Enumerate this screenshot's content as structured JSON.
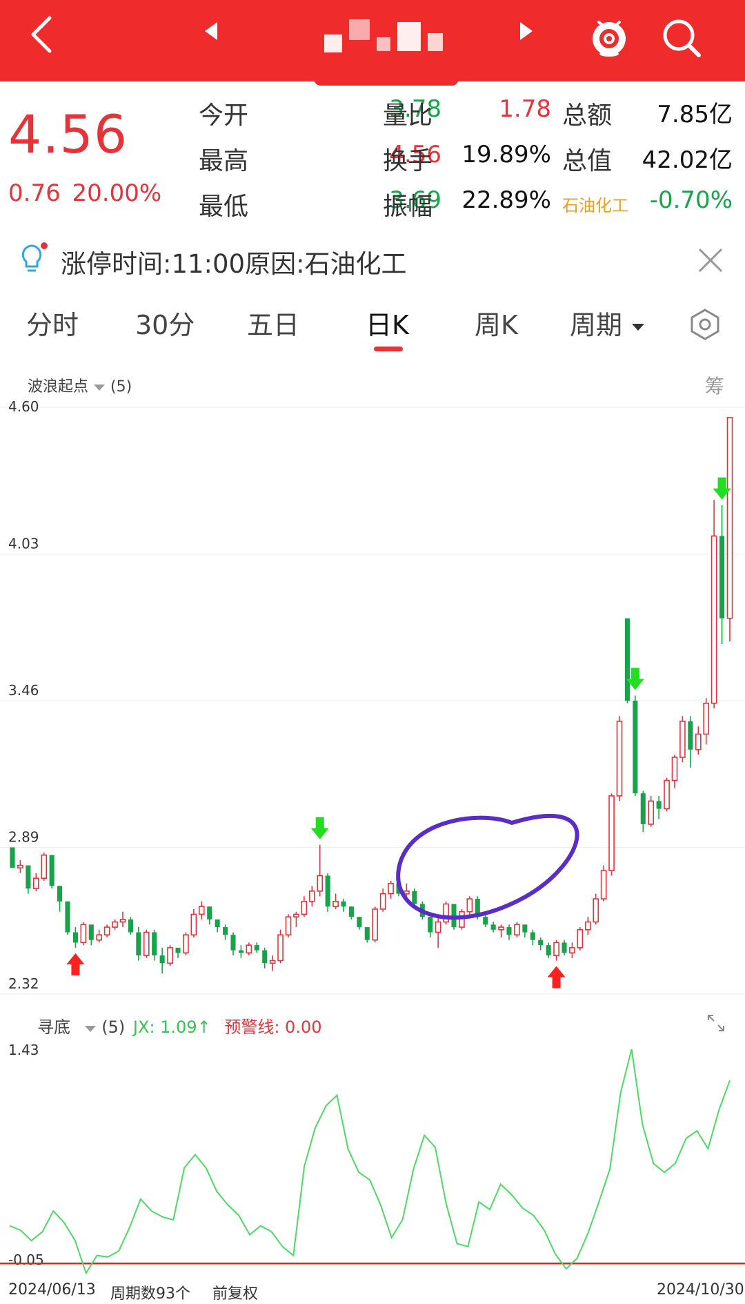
{
  "header": {
    "back_icon": "chevron-left-icon",
    "prev_icon": "triangle-left-icon",
    "next_icon": "triangle-right-icon",
    "mascot_icon": "mascot-icon",
    "search_icon": "search-icon"
  },
  "quote": {
    "price": "4.56",
    "change": "0.76",
    "change_pct": "20.00%",
    "rows": [
      [
        {
          "label": "今开",
          "value": "3.78",
          "color": "green"
        },
        {
          "label": "量比",
          "value": "1.78",
          "color": "red"
        },
        {
          "label": "总额",
          "value": "7.85亿",
          "color": "dark"
        }
      ],
      [
        {
          "label": "最高",
          "value": "4.56",
          "color": "red"
        },
        {
          "label": "换手",
          "value": "19.89%",
          "color": "dark"
        },
        {
          "label": "总值",
          "value": "42.02亿",
          "color": "dark"
        }
      ],
      [
        {
          "label": "最低",
          "value": "3.69",
          "color": "green"
        },
        {
          "label": "振幅",
          "value": "22.89%",
          "color": "dark"
        },
        {
          "label": "石油化工",
          "value": "-0.70%",
          "color": "green"
        }
      ]
    ]
  },
  "limit_info": {
    "text": "涨停时间:11:00原因:石油化工",
    "icon": "lightbulb-icon",
    "close_icon": "close-icon"
  },
  "tabs": {
    "items": [
      "分时",
      "30分",
      "五日",
      "日K",
      "周K",
      "周期"
    ],
    "active": "日K",
    "dropdown_icon": "caret-down-icon",
    "settings_icon": "hexagon-settings-icon"
  },
  "main_indicator": {
    "name": "波浪起点",
    "param": "(5)",
    "chips_label": "筹"
  },
  "sub_indicator": {
    "name": "寻底",
    "param": "(5)",
    "jx_text": "JX: 1.09↑",
    "warn_text": "预警线: 0.00",
    "expand_icon": "expand-icon"
  },
  "footer": {
    "start_date": "2024/06/13",
    "period_count": "周期数93个",
    "adjust": "前复权",
    "end_date": "2024/10/30"
  },
  "colors": {
    "brand_red": "#f02b2b",
    "up_red": "#e8323a",
    "down_green": "#18a24a",
    "jx_line": "#4cd964",
    "circle": "#5a2dc8"
  },
  "chart_data": [
    {
      "type": "candlestick",
      "title": "",
      "yticks": [
        "4.60",
        "4.03",
        "3.46",
        "2.89",
        "2.32"
      ],
      "ylim": [
        2.32,
        4.6
      ],
      "candles": [
        [
          2.89,
          2.89,
          2.81,
          2.81
        ],
        [
          2.81,
          2.84,
          2.79,
          2.82
        ],
        [
          2.82,
          2.82,
          2.71,
          2.73
        ],
        [
          2.73,
          2.79,
          2.72,
          2.77
        ],
        [
          2.77,
          2.87,
          2.76,
          2.86
        ],
        [
          2.86,
          2.86,
          2.73,
          2.74
        ],
        [
          2.74,
          2.74,
          2.64,
          2.68
        ],
        [
          2.68,
          2.68,
          2.55,
          2.56
        ],
        [
          2.56,
          2.58,
          2.5,
          2.52
        ],
        [
          2.52,
          2.6,
          2.51,
          2.59
        ],
        [
          2.59,
          2.59,
          2.51,
          2.53
        ],
        [
          2.53,
          2.57,
          2.52,
          2.55
        ],
        [
          2.55,
          2.59,
          2.54,
          2.58
        ],
        [
          2.58,
          2.61,
          2.57,
          2.6
        ],
        [
          2.6,
          2.64,
          2.58,
          2.61
        ],
        [
          2.61,
          2.62,
          2.55,
          2.56
        ],
        [
          2.56,
          2.58,
          2.45,
          2.47
        ],
        [
          2.47,
          2.57,
          2.46,
          2.56
        ],
        [
          2.56,
          2.57,
          2.45,
          2.47
        ],
        [
          2.47,
          2.5,
          2.4,
          2.44
        ],
        [
          2.44,
          2.51,
          2.43,
          2.5
        ],
        [
          2.5,
          2.5,
          2.46,
          2.48
        ],
        [
          2.48,
          2.56,
          2.47,
          2.55
        ],
        [
          2.55,
          2.65,
          2.54,
          2.63
        ],
        [
          2.63,
          2.68,
          2.61,
          2.66
        ],
        [
          2.66,
          2.66,
          2.59,
          2.61
        ],
        [
          2.61,
          2.61,
          2.56,
          2.58
        ],
        [
          2.58,
          2.59,
          2.53,
          2.55
        ],
        [
          2.55,
          2.56,
          2.47,
          2.49
        ],
        [
          2.49,
          2.51,
          2.46,
          2.48
        ],
        [
          2.48,
          2.52,
          2.47,
          2.51
        ],
        [
          2.51,
          2.52,
          2.48,
          2.49
        ],
        [
          2.49,
          2.5,
          2.42,
          2.44
        ],
        [
          2.44,
          2.47,
          2.41,
          2.45
        ],
        [
          2.45,
          2.57,
          2.44,
          2.55
        ],
        [
          2.55,
          2.63,
          2.54,
          2.62
        ],
        [
          2.62,
          2.64,
          2.58,
          2.63
        ],
        [
          2.63,
          2.7,
          2.62,
          2.68
        ],
        [
          2.68,
          2.74,
          2.66,
          2.72
        ],
        [
          2.72,
          2.9,
          2.7,
          2.78
        ],
        [
          2.78,
          2.79,
          2.64,
          2.66
        ],
        [
          2.66,
          2.71,
          2.65,
          2.68
        ],
        [
          2.68,
          2.69,
          2.64,
          2.66
        ],
        [
          2.66,
          2.66,
          2.61,
          2.62
        ],
        [
          2.62,
          2.62,
          2.57,
          2.58
        ],
        [
          2.58,
          2.58,
          2.52,
          2.53
        ],
        [
          2.53,
          2.66,
          2.52,
          2.65
        ],
        [
          2.65,
          2.73,
          2.64,
          2.71
        ],
        [
          2.71,
          2.76,
          2.69,
          2.75
        ],
        [
          2.75,
          2.77,
          2.7,
          2.71
        ],
        [
          2.71,
          2.75,
          2.68,
          2.72
        ],
        [
          2.72,
          2.73,
          2.66,
          2.67
        ],
        [
          2.67,
          2.68,
          2.61,
          2.62
        ],
        [
          2.62,
          2.62,
          2.54,
          2.56
        ],
        [
          2.56,
          2.62,
          2.5,
          2.6
        ],
        [
          2.6,
          2.68,
          2.59,
          2.67
        ],
        [
          2.67,
          2.67,
          2.57,
          2.58
        ],
        [
          2.58,
          2.65,
          2.57,
          2.64
        ],
        [
          2.64,
          2.7,
          2.62,
          2.69
        ],
        [
          2.69,
          2.7,
          2.61,
          2.62
        ],
        [
          2.62,
          2.64,
          2.58,
          2.59
        ],
        [
          2.59,
          2.6,
          2.56,
          2.57
        ],
        [
          2.57,
          2.59,
          2.54,
          2.58
        ],
        [
          2.58,
          2.59,
          2.53,
          2.55
        ],
        [
          2.55,
          2.6,
          2.54,
          2.59
        ],
        [
          2.59,
          2.59,
          2.54,
          2.56
        ],
        [
          2.56,
          2.57,
          2.51,
          2.53
        ],
        [
          2.53,
          2.54,
          2.49,
          2.51
        ],
        [
          2.51,
          2.52,
          2.46,
          2.47
        ],
        [
          2.47,
          2.53,
          2.45,
          2.52
        ],
        [
          2.52,
          2.53,
          2.47,
          2.48
        ],
        [
          2.48,
          2.52,
          2.46,
          2.5
        ],
        [
          2.5,
          2.58,
          2.49,
          2.57
        ],
        [
          2.57,
          2.62,
          2.55,
          2.6
        ],
        [
          2.6,
          2.71,
          2.59,
          2.69
        ],
        [
          2.69,
          2.82,
          2.68,
          2.8
        ],
        [
          2.8,
          3.1,
          2.78,
          3.09
        ],
        [
          3.09,
          3.4,
          3.07,
          3.38
        ],
        [
          3.78,
          3.78,
          3.45,
          3.46
        ],
        [
          3.46,
          3.48,
          3.09,
          3.1
        ],
        [
          3.1,
          3.11,
          2.95,
          2.98
        ],
        [
          2.98,
          3.09,
          2.97,
          3.07
        ],
        [
          3.07,
          3.09,
          3.0,
          3.04
        ],
        [
          3.04,
          3.16,
          3.03,
          3.15
        ],
        [
          3.15,
          3.25,
          3.12,
          3.24
        ],
        [
          3.24,
          3.4,
          3.22,
          3.38
        ],
        [
          3.38,
          3.4,
          3.2,
          3.27
        ],
        [
          3.27,
          3.36,
          3.25,
          3.33
        ],
        [
          3.33,
          3.47,
          3.29,
          3.45
        ],
        [
          3.45,
          4.24,
          3.43,
          4.1
        ],
        [
          4.1,
          4.22,
          3.68,
          3.78
        ],
        [
          3.78,
          4.56,
          3.69,
          4.56
        ]
      ]
    },
    {
      "type": "line",
      "title": "",
      "yticks": [
        "1.43",
        "-0.05"
      ],
      "ylim": [
        -0.05,
        1.43
      ],
      "series": [
        {
          "name": "JX",
          "values": [
            0.24,
            0.21,
            0.14,
            0.2,
            0.34,
            0.26,
            0.14,
            -0.08,
            0.04,
            0.03,
            0.07,
            0.23,
            0.42,
            0.34,
            0.3,
            0.28,
            0.63,
            0.72,
            0.63,
            0.47,
            0.38,
            0.31,
            0.18,
            0.24,
            0.2,
            0.1,
            0.04,
            0.64,
            0.9,
            1.05,
            1.12,
            0.76,
            0.6,
            0.55,
            0.38,
            0.16,
            0.28,
            0.62,
            0.85,
            0.77,
            0.39,
            0.12,
            0.1,
            0.4,
            0.35,
            0.52,
            0.45,
            0.36,
            0.31,
            0.21,
            0.05,
            -0.05,
            0.02,
            0.19,
            0.4,
            0.62,
            1.14,
            1.43,
            0.92,
            0.66,
            0.6,
            0.66,
            0.83,
            0.88,
            0.76,
            1.02,
            1.22
          ]
        }
      ]
    }
  ]
}
